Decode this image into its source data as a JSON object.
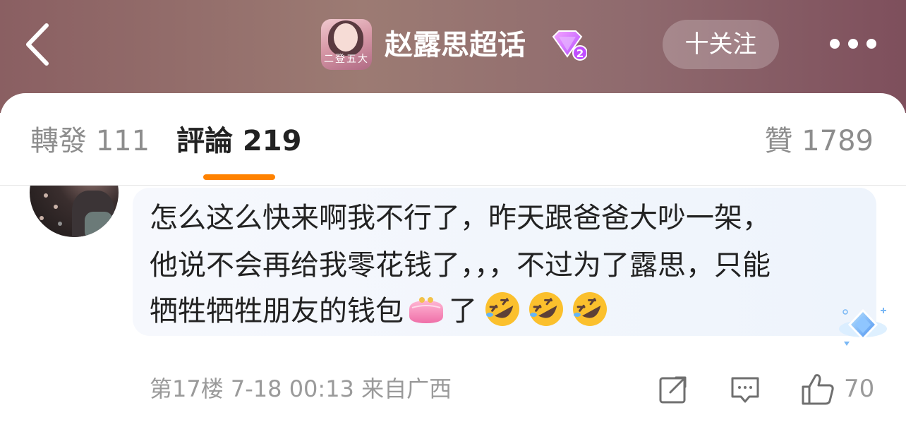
{
  "header": {
    "topic_title": "赵露思超话",
    "topic_avatar_caption": "二登五大",
    "follow_label": "十关注",
    "gem_level": "2"
  },
  "tabs": [
    {
      "label": "轉發 111"
    },
    {
      "label": "評論 219"
    },
    {
      "label": "贊 1789"
    }
  ],
  "comment": {
    "lines": [
      "怎么这么快来啊我不行了，昨天跟爸爸大吵一架，",
      "他说不会再给我零花钱了，，，不过为了露思，只能",
      "牺牲牺牲朋友的钱包"
    ],
    "line3_tail": "了",
    "emojis": [
      "purse-emoji",
      "rolling-on-floor-laughing-emoji",
      "rolling-on-floor-laughing-emoji",
      "rolling-on-floor-laughing-emoji"
    ],
    "meta": "第17楼 7-18 00:13 来自广西",
    "like_count": "70"
  },
  "colors": {
    "accent": "#ff8200",
    "header_bg": "#8f6a6e",
    "bubble_bg": "#eef4fc",
    "muted_text": "#9a9a9a"
  }
}
